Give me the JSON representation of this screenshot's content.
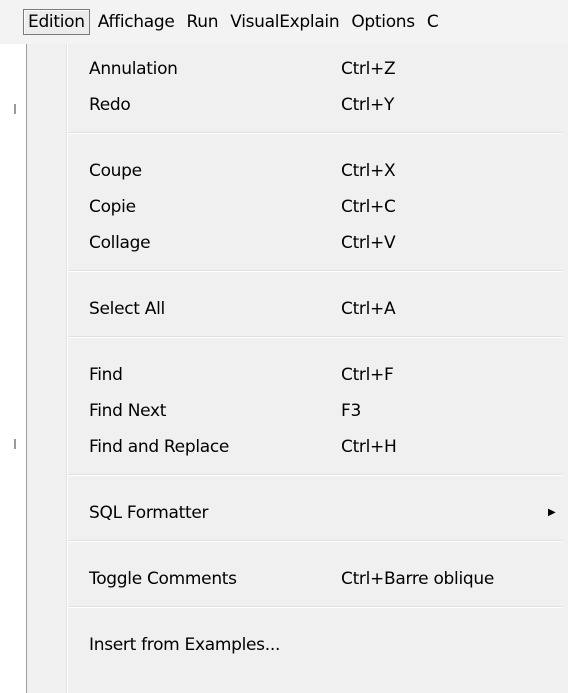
{
  "menubar": {
    "items": [
      "Edition",
      "Affichage",
      "Run",
      "VisualExplain",
      "Options",
      "C"
    ],
    "active_index": 0
  },
  "edit_menu": {
    "groups": [
      [
        {
          "label": "Annulation",
          "shortcut": "Ctrl+Z"
        },
        {
          "label": "Redo",
          "shortcut": "Ctrl+Y"
        }
      ],
      [
        {
          "label": "Coupe",
          "shortcut": "Ctrl+X"
        },
        {
          "label": "Copie",
          "shortcut": "Ctrl+C"
        },
        {
          "label": "Collage",
          "shortcut": "Ctrl+V"
        }
      ],
      [
        {
          "label": "Select All",
          "shortcut": "Ctrl+A"
        }
      ],
      [
        {
          "label": "Find",
          "shortcut": "Ctrl+F"
        },
        {
          "label": "Find Next",
          "shortcut": "F3"
        },
        {
          "label": "Find and Replace",
          "shortcut": "Ctrl+H"
        }
      ],
      [
        {
          "label": "SQL Formatter",
          "shortcut": "",
          "submenu": true,
          "submenu_icon": "triangle-right-icon"
        }
      ],
      [
        {
          "label": "Toggle Comments",
          "shortcut": "Ctrl+Barre oblique"
        }
      ],
      [
        {
          "label": "Insert from Examples...",
          "shortcut": ""
        }
      ]
    ]
  },
  "colors": {
    "menu_background": "#f0f0f0",
    "menubar_background": "#f3f3f3",
    "separator": "#e0e0e0",
    "text": "#000000"
  }
}
